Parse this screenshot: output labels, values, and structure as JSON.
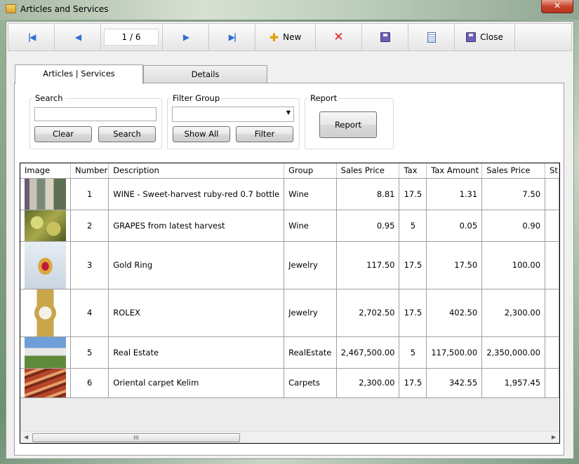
{
  "window": {
    "title": "Articles and Services",
    "close_glyph": "✕"
  },
  "toolbar": {
    "counter": "1 / 6",
    "new_label": "New",
    "close_label": "Close",
    "icons": [
      "first-record-icon",
      "previous-record-icon",
      "next-record-icon",
      "last-record-icon",
      "plus-icon",
      "delete-x-icon",
      "save-disk-icon",
      "document-icon",
      "close-disk-icon"
    ]
  },
  "tabs": [
    {
      "label": "Articles | Services"
    },
    {
      "label": "Details"
    }
  ],
  "search": {
    "group_label": "Search",
    "value": "",
    "clear_label": "Clear",
    "search_label": "Search"
  },
  "filter": {
    "group_label": "Filter Group",
    "selected": "",
    "show_all_label": "Show All",
    "filter_label": "Filter"
  },
  "report": {
    "group_label": "Report",
    "button_label": "Report"
  },
  "grid": {
    "columns": [
      "Image",
      "Number",
      "Description",
      "Group",
      "Sales Price",
      "Tax",
      "Tax Amount",
      "Sales Price",
      "St"
    ],
    "rows": [
      {
        "image": "wine-shelf-photo",
        "number": "1",
        "description": "WINE - Sweet-harvest ruby-red 0.7 bottle",
        "group": "Wine",
        "sales_price": "8.81",
        "tax": "17.5",
        "tax_amount": "1.31",
        "net_price": "7.50"
      },
      {
        "image": "grapes-photo",
        "number": "2",
        "description": "GRAPES from latest harvest",
        "group": "Wine",
        "sales_price": "0.95",
        "tax": "5",
        "tax_amount": "0.05",
        "net_price": "0.90"
      },
      {
        "image": "gold-ring-photo",
        "number": "3",
        "description": "Gold Ring",
        "group": "Jewelry",
        "sales_price": "117.50",
        "tax": "17.5",
        "tax_amount": "17.50",
        "net_price": "100.00"
      },
      {
        "image": "rolex-watch-photo",
        "number": "4",
        "description": "ROLEX",
        "group": "Jewelry",
        "sales_price": "2,702.50",
        "tax": "17.5",
        "tax_amount": "402.50",
        "net_price": "2,300.00"
      },
      {
        "image": "house-photo",
        "number": "5",
        "description": "Real Estate",
        "group": "RealEstate",
        "sales_price": "2,467,500.00",
        "tax": "5",
        "tax_amount": "117,500.00",
        "net_price": "2,350,000.00"
      },
      {
        "image": "carpet-photo",
        "number": "6",
        "description": "Oriental carpet Kelim",
        "group": "Carpets",
        "sales_price": "2,300.00",
        "tax": "17.5",
        "tax_amount": "342.55",
        "net_price": "1,957.45"
      }
    ],
    "scroll_thumb_glyph": "III"
  },
  "colors": {
    "nav_blue": "#2f6fd2",
    "new_plus": "#e0a000",
    "delete_red": "#e02020",
    "disk_purple": "#6a5fb5"
  }
}
